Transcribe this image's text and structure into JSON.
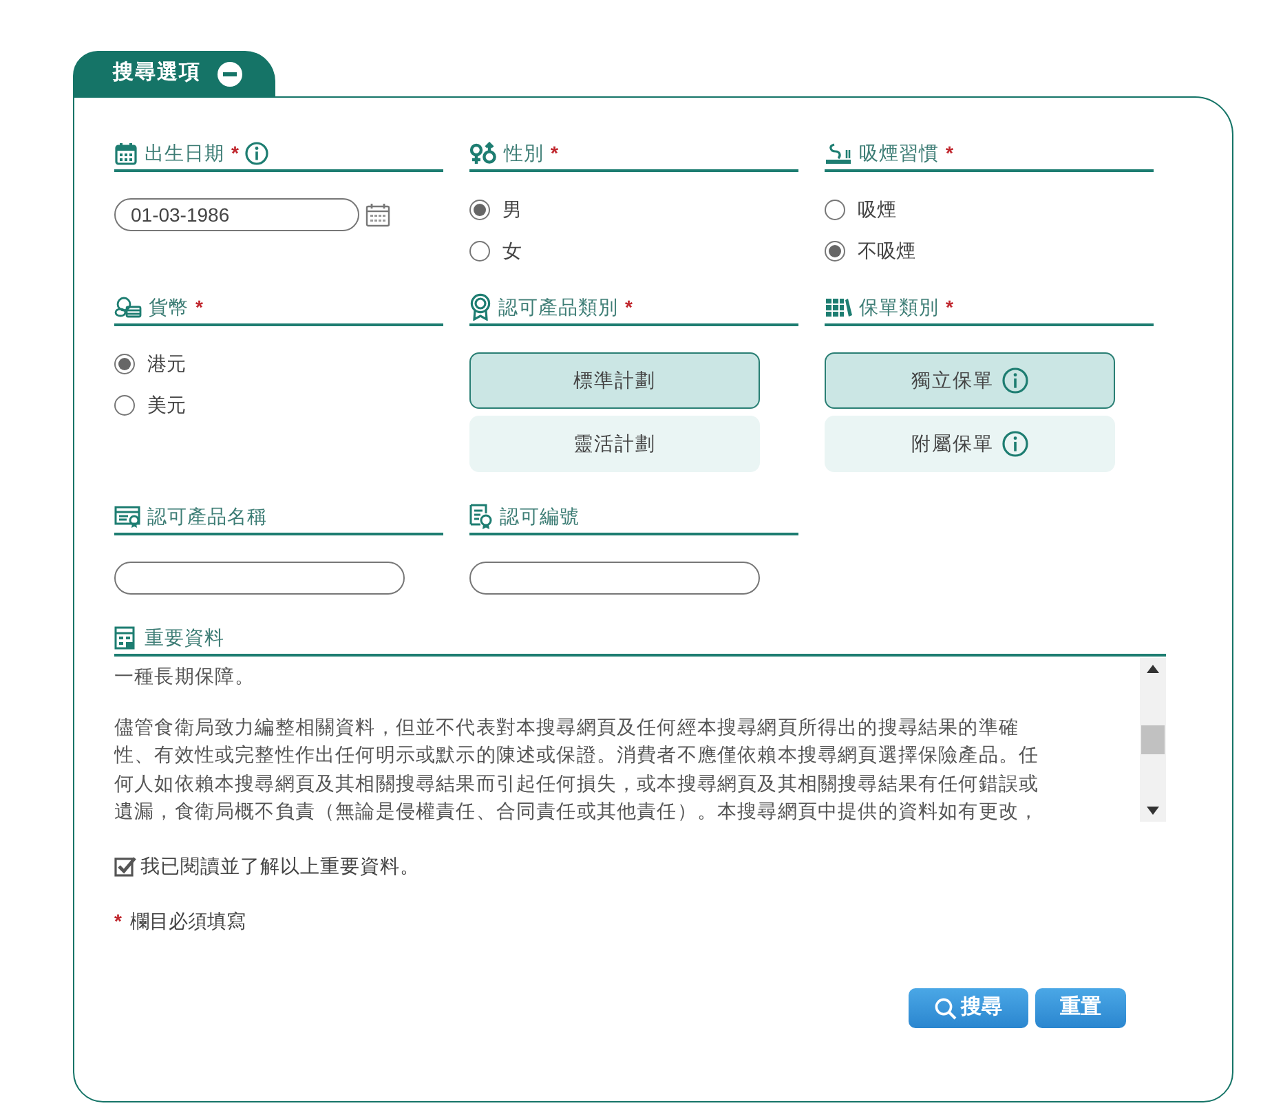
{
  "panel": {
    "title": "搜尋選項",
    "expanded": true
  },
  "fields": [
    {
      "kind": "date",
      "label": "出生日期",
      "required": true,
      "info": true,
      "value": "01-03-1986"
    },
    {
      "kind": "radio",
      "label": "性別",
      "required": true,
      "options": [
        {
          "label": "男",
          "selected": true
        },
        {
          "label": "女",
          "selected": false
        }
      ]
    },
    {
      "kind": "radio",
      "label": "吸煙習慣",
      "required": true,
      "options": [
        {
          "label": "吸煙",
          "selected": false
        },
        {
          "label": "不吸煙",
          "selected": true
        }
      ]
    },
    {
      "kind": "radio",
      "label": "貨幣",
      "required": true,
      "options": [
        {
          "label": "港元",
          "selected": true
        },
        {
          "label": "美元",
          "selected": false
        }
      ]
    },
    {
      "kind": "choice",
      "label": "認可產品類別",
      "required": true,
      "options": [
        {
          "label": "標準計劃",
          "selected": true,
          "info": false
        },
        {
          "label": "靈活計劃",
          "selected": false,
          "info": false
        }
      ]
    },
    {
      "kind": "choice",
      "label": "保單類別",
      "required": true,
      "options": [
        {
          "label": "獨立保單",
          "selected": true,
          "info": true
        },
        {
          "label": "附屬保單",
          "selected": false,
          "info": true
        }
      ]
    },
    {
      "kind": "text",
      "label": "認可產品名稱",
      "required": false
    },
    {
      "kind": "text",
      "label": "認可編號",
      "required": false
    }
  ],
  "important_info": {
    "label": "重要資料",
    "paragraphs": [
      {
        "lines": [
          "一種長期保障。"
        ]
      },
      {
        "lines": [
          "儘管食衛局致力編整相關資料，但並不代表對本搜尋網頁及任何經本搜尋網頁所得出的搜尋結果的準確",
          "性、有效性或完整性作出任何明示或默示的陳述或保證。消費者不應僅依賴本搜尋網頁選擇保險產品。任",
          "何人如依賴本搜尋網頁及其相關搜尋結果而引起任何損失，或本搜尋網頁及其相關搜尋結果有任何錯誤或",
          "遺漏，食衛局概不負責（無論是侵權責任、合同責任或其他責任）。本搜尋網頁中提供的資料如有更改，"
        ]
      }
    ]
  },
  "acknowledge": {
    "label": "我已閱讀並了解以上重要資料。",
    "checked": true
  },
  "required_note": {
    "mark": "*",
    "text": "欄目必須填寫"
  },
  "buttons": [
    {
      "kind": "search",
      "label": "搜尋"
    },
    {
      "kind": "reset",
      "label": "重置"
    }
  ]
}
